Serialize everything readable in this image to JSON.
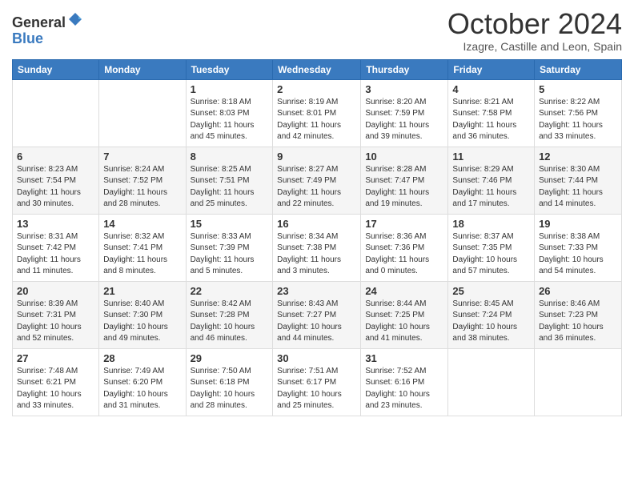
{
  "header": {
    "logo_general": "General",
    "logo_blue": "Blue",
    "month_title": "October 2024",
    "subtitle": "Izagre, Castille and Leon, Spain"
  },
  "weekdays": [
    "Sunday",
    "Monday",
    "Tuesday",
    "Wednesday",
    "Thursday",
    "Friday",
    "Saturday"
  ],
  "weeks": [
    [
      {
        "day": "",
        "info": ""
      },
      {
        "day": "",
        "info": ""
      },
      {
        "day": "1",
        "info": "Sunrise: 8:18 AM\nSunset: 8:03 PM\nDaylight: 11 hours and 45 minutes."
      },
      {
        "day": "2",
        "info": "Sunrise: 8:19 AM\nSunset: 8:01 PM\nDaylight: 11 hours and 42 minutes."
      },
      {
        "day": "3",
        "info": "Sunrise: 8:20 AM\nSunset: 7:59 PM\nDaylight: 11 hours and 39 minutes."
      },
      {
        "day": "4",
        "info": "Sunrise: 8:21 AM\nSunset: 7:58 PM\nDaylight: 11 hours and 36 minutes."
      },
      {
        "day": "5",
        "info": "Sunrise: 8:22 AM\nSunset: 7:56 PM\nDaylight: 11 hours and 33 minutes."
      }
    ],
    [
      {
        "day": "6",
        "info": "Sunrise: 8:23 AM\nSunset: 7:54 PM\nDaylight: 11 hours and 30 minutes."
      },
      {
        "day": "7",
        "info": "Sunrise: 8:24 AM\nSunset: 7:52 PM\nDaylight: 11 hours and 28 minutes."
      },
      {
        "day": "8",
        "info": "Sunrise: 8:25 AM\nSunset: 7:51 PM\nDaylight: 11 hours and 25 minutes."
      },
      {
        "day": "9",
        "info": "Sunrise: 8:27 AM\nSunset: 7:49 PM\nDaylight: 11 hours and 22 minutes."
      },
      {
        "day": "10",
        "info": "Sunrise: 8:28 AM\nSunset: 7:47 PM\nDaylight: 11 hours and 19 minutes."
      },
      {
        "day": "11",
        "info": "Sunrise: 8:29 AM\nSunset: 7:46 PM\nDaylight: 11 hours and 17 minutes."
      },
      {
        "day": "12",
        "info": "Sunrise: 8:30 AM\nSunset: 7:44 PM\nDaylight: 11 hours and 14 minutes."
      }
    ],
    [
      {
        "day": "13",
        "info": "Sunrise: 8:31 AM\nSunset: 7:42 PM\nDaylight: 11 hours and 11 minutes."
      },
      {
        "day": "14",
        "info": "Sunrise: 8:32 AM\nSunset: 7:41 PM\nDaylight: 11 hours and 8 minutes."
      },
      {
        "day": "15",
        "info": "Sunrise: 8:33 AM\nSunset: 7:39 PM\nDaylight: 11 hours and 5 minutes."
      },
      {
        "day": "16",
        "info": "Sunrise: 8:34 AM\nSunset: 7:38 PM\nDaylight: 11 hours and 3 minutes."
      },
      {
        "day": "17",
        "info": "Sunrise: 8:36 AM\nSunset: 7:36 PM\nDaylight: 11 hours and 0 minutes."
      },
      {
        "day": "18",
        "info": "Sunrise: 8:37 AM\nSunset: 7:35 PM\nDaylight: 10 hours and 57 minutes."
      },
      {
        "day": "19",
        "info": "Sunrise: 8:38 AM\nSunset: 7:33 PM\nDaylight: 10 hours and 54 minutes."
      }
    ],
    [
      {
        "day": "20",
        "info": "Sunrise: 8:39 AM\nSunset: 7:31 PM\nDaylight: 10 hours and 52 minutes."
      },
      {
        "day": "21",
        "info": "Sunrise: 8:40 AM\nSunset: 7:30 PM\nDaylight: 10 hours and 49 minutes."
      },
      {
        "day": "22",
        "info": "Sunrise: 8:42 AM\nSunset: 7:28 PM\nDaylight: 10 hours and 46 minutes."
      },
      {
        "day": "23",
        "info": "Sunrise: 8:43 AM\nSunset: 7:27 PM\nDaylight: 10 hours and 44 minutes."
      },
      {
        "day": "24",
        "info": "Sunrise: 8:44 AM\nSunset: 7:25 PM\nDaylight: 10 hours and 41 minutes."
      },
      {
        "day": "25",
        "info": "Sunrise: 8:45 AM\nSunset: 7:24 PM\nDaylight: 10 hours and 38 minutes."
      },
      {
        "day": "26",
        "info": "Sunrise: 8:46 AM\nSunset: 7:23 PM\nDaylight: 10 hours and 36 minutes."
      }
    ],
    [
      {
        "day": "27",
        "info": "Sunrise: 7:48 AM\nSunset: 6:21 PM\nDaylight: 10 hours and 33 minutes."
      },
      {
        "day": "28",
        "info": "Sunrise: 7:49 AM\nSunset: 6:20 PM\nDaylight: 10 hours and 31 minutes."
      },
      {
        "day": "29",
        "info": "Sunrise: 7:50 AM\nSunset: 6:18 PM\nDaylight: 10 hours and 28 minutes."
      },
      {
        "day": "30",
        "info": "Sunrise: 7:51 AM\nSunset: 6:17 PM\nDaylight: 10 hours and 25 minutes."
      },
      {
        "day": "31",
        "info": "Sunrise: 7:52 AM\nSunset: 6:16 PM\nDaylight: 10 hours and 23 minutes."
      },
      {
        "day": "",
        "info": ""
      },
      {
        "day": "",
        "info": ""
      }
    ]
  ]
}
